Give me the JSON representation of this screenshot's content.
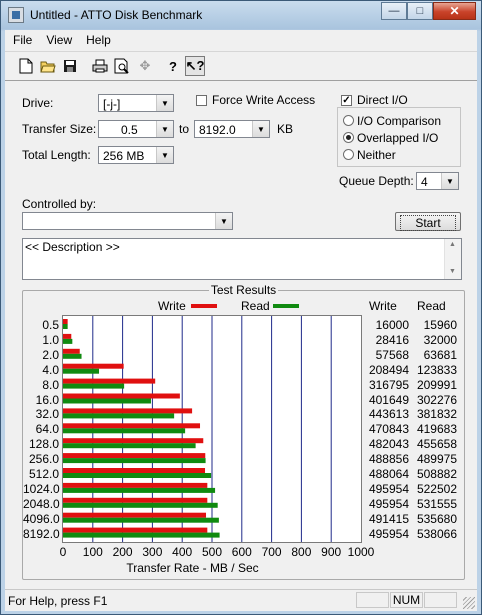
{
  "window": {
    "title": "Untitled - ATTO Disk Benchmark"
  },
  "menu": [
    "File",
    "View",
    "Help"
  ],
  "toolbar": {
    "icons": [
      "new-file-icon",
      "open-folder-icon",
      "save-icon",
      "print-icon",
      "print-preview-icon",
      "move-icon",
      "help-icon",
      "context-help-icon"
    ]
  },
  "form": {
    "drive_label": "Drive:",
    "drive_value": "[-j-]",
    "force_write_label": "Force Write Access",
    "force_write_checked": false,
    "direct_io_label": "Direct I/O",
    "direct_io_checked": true,
    "transfer_size_label": "Transfer Size:",
    "transfer_from": "0.5",
    "to_label": "to",
    "transfer_to": "8192.0",
    "kb_label": "KB",
    "total_length_label": "Total Length:",
    "total_length_value": "256 MB",
    "io_comparison_label": "I/O Comparison",
    "overlapped_io_label": "Overlapped I/O",
    "neither_label": "Neither",
    "io_mode_selected": "Overlapped I/O",
    "queue_depth_label": "Queue Depth:",
    "queue_depth_value": "4",
    "controlled_by_label": "Controlled by:",
    "controlled_by_value": "",
    "start_label": "Start",
    "description": "<< Description >>"
  },
  "results": {
    "title": "Test Results",
    "legend_write": "Write",
    "legend_read": "Read",
    "col_write": "Write",
    "col_read": "Read",
    "rows": [
      {
        "size": "0.5",
        "write": "16000",
        "read": "15960"
      },
      {
        "size": "1.0",
        "write": "28416",
        "read": "32000"
      },
      {
        "size": "2.0",
        "write": "57568",
        "read": "63681"
      },
      {
        "size": "4.0",
        "write": "208494",
        "read": "123833"
      },
      {
        "size": "8.0",
        "write": "316795",
        "read": "209991"
      },
      {
        "size": "16.0",
        "write": "401649",
        "read": "302276"
      },
      {
        "size": "32.0",
        "write": "443613",
        "read": "381832"
      },
      {
        "size": "64.0",
        "write": "470843",
        "read": "419683"
      },
      {
        "size": "128.0",
        "write": "482043",
        "read": "455658"
      },
      {
        "size": "256.0",
        "write": "488856",
        "read": "489975"
      },
      {
        "size": "512.0",
        "write": "488064",
        "read": "508882"
      },
      {
        "size": "1024.0",
        "write": "495954",
        "read": "522502"
      },
      {
        "size": "2048.0",
        "write": "495954",
        "read": "531555"
      },
      {
        "size": "4096.0",
        "write": "491415",
        "read": "535680"
      },
      {
        "size": "8192.0",
        "write": "495954",
        "read": "538066"
      }
    ],
    "x_ticks": [
      "0",
      "100",
      "200",
      "300",
      "400",
      "500",
      "600",
      "700",
      "800",
      "900",
      "1000"
    ],
    "x_label": "Transfer Rate - MB / Sec"
  },
  "chart_data": {
    "type": "bar",
    "orientation": "horizontal",
    "categories": [
      "0.5",
      "1.0",
      "2.0",
      "4.0",
      "8.0",
      "16.0",
      "32.0",
      "64.0",
      "128.0",
      "256.0",
      "512.0",
      "1024.0",
      "2048.0",
      "4096.0",
      "8192.0"
    ],
    "series": [
      {
        "name": "Write",
        "color": "#e01010",
        "values": [
          15.6,
          27.8,
          56.2,
          203.6,
          309.4,
          392.2,
          433.2,
          459.8,
          470.7,
          477.4,
          476.6,
          484.3,
          484.3,
          479.9,
          484.3
        ]
      },
      {
        "name": "Read",
        "color": "#108a10",
        "values": [
          15.6,
          31.3,
          62.2,
          120.9,
          205.1,
          295.2,
          372.9,
          409.8,
          445.0,
          478.5,
          497.0,
          510.3,
          519.1,
          523.1,
          525.5
        ]
      }
    ],
    "xlabel": "Transfer Rate - MB / Sec",
    "xlim": [
      0,
      1000
    ],
    "grid": true,
    "legend": "top"
  },
  "status": {
    "text": "For Help, press F1",
    "num": "NUM"
  }
}
